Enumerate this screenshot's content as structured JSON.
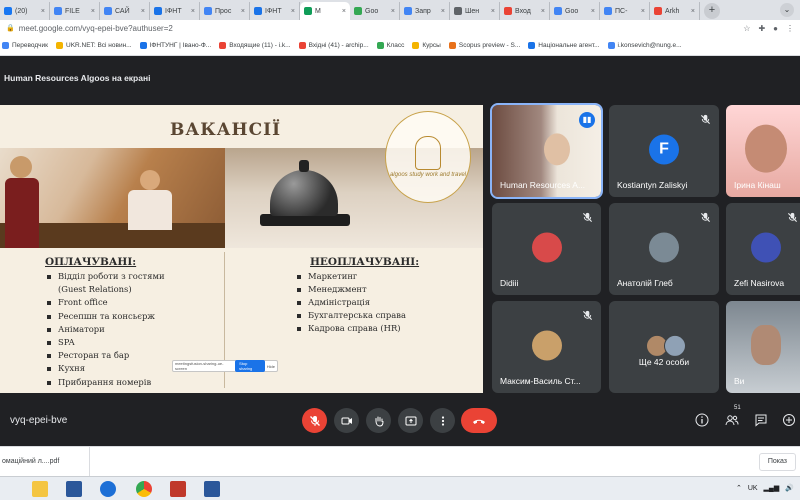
{
  "browser": {
    "tabs": [
      {
        "label": "(20)",
        "color": "#1877f2"
      },
      {
        "label": "FILE",
        "color": "#4285f4"
      },
      {
        "label": "САЙ",
        "color": "#4285f4"
      },
      {
        "label": "ІФНТ",
        "color": "#1a73e8"
      },
      {
        "label": "Прос",
        "color": "#4285f4"
      },
      {
        "label": "ІФНТ",
        "color": "#1a73e8"
      },
      {
        "label": "M",
        "color": "#0f9d58",
        "active": true
      },
      {
        "label": "Goo",
        "color": "#34a853"
      },
      {
        "label": "Запр",
        "color": "#4285f4"
      },
      {
        "label": "Шен",
        "color": "#5f6368"
      },
      {
        "label": "Вход",
        "color": "#ea4335"
      },
      {
        "label": "Goo",
        "color": "#4285f4"
      },
      {
        "label": "ПС-",
        "color": "#4285f4"
      },
      {
        "label": "Arkh",
        "color": "#ea4335"
      }
    ],
    "new_tab": "+",
    "tab_dropdown": "⌄",
    "url": "meet.google.com/vyq-epei-bve?authuser=2",
    "bookmarks": [
      {
        "label": "Переводчик",
        "color": "#4285f4"
      },
      {
        "label": "UKR.NET: Всі новин...",
        "color": "#f4b400"
      },
      {
        "label": "ІФНТУНГ | Івано-Ф...",
        "color": "#1a73e8"
      },
      {
        "label": "Входящие (11) - i.k...",
        "color": "#ea4335"
      },
      {
        "label": "Вхідні (41) - archip...",
        "color": "#ea4335"
      },
      {
        "label": "Класс",
        "color": "#34a853"
      },
      {
        "label": "Курсы",
        "color": "#f4b400"
      },
      {
        "label": "Scopus preview - S...",
        "color": "#e8711a"
      },
      {
        "label": "Національне агент...",
        "color": "#1a73e8"
      },
      {
        "label": "i.konsevich@nung.e...",
        "color": "#4285f4"
      }
    ]
  },
  "meet": {
    "presenting_label": "Human Resources Algoos на екрані",
    "meeting_code": "vyq-epei-bve",
    "participant_count": "51",
    "slide": {
      "title": "ВАКАНСІЇ",
      "logo_text": "algoos study work and travel",
      "paid_heading": "ОПЛАЧУВАНІ:",
      "paid_items": [
        "Відділ роботи з гостями",
        "(Guest Relations)",
        "Front office",
        "Ресепшн та консьєрж",
        "Аніматори",
        "SPA",
        "Ресторан та бар",
        "Кухня",
        "Прибирання номерів"
      ],
      "unpaid_heading": "НЕОПЛАЧУВАНІ:",
      "unpaid_items": [
        "Маркетинг",
        "Менеджмент",
        "Адміністрація",
        "Бухгалтерська справа",
        "Кадрова справа (HR)"
      ],
      "extension_text": "meetingsfusion-sharing-ue-screen",
      "extension_button": "Stop sharing",
      "extension_hide": "Hide"
    },
    "tiles": [
      {
        "name": "Human Resources A...",
        "avatar_letter": "",
        "avatar_color": "#8d6e63"
      },
      {
        "name": "Kostiantyn Zaliskyi",
        "avatar_letter": "F",
        "avatar_color": "#1a73e8"
      },
      {
        "name": "Ірина Кінаш",
        "avatar_letter": "",
        "avatar_color": "#b0776a"
      },
      {
        "name": "Didiii",
        "avatar_letter": "",
        "avatar_color": "#d84a4a"
      },
      {
        "name": "Анатолій Глеб",
        "avatar_letter": "",
        "avatar_color": "#7b8a95"
      },
      {
        "name": "Zefi Nasirova",
        "avatar_letter": "",
        "avatar_color": "#3f51b5"
      },
      {
        "name": "Максим-Василь Ст...",
        "avatar_letter": "",
        "avatar_color": "#c9a06a"
      },
      {
        "name": "Ще 42 особи",
        "avatar_letter": "",
        "avatar_color": "#8a7a6a"
      },
      {
        "name": "Ви",
        "avatar_letter": "",
        "avatar_color": "#9aa5b1"
      }
    ]
  },
  "downloads": {
    "item": "омаційний л....pdf",
    "show_all": "Показ"
  },
  "taskbar": {
    "lang": "UK"
  },
  "colors": {
    "meet_bg": "#202124",
    "tile_bg": "#3c4043",
    "danger": "#ea4335",
    "accent": "#1a73e8"
  }
}
